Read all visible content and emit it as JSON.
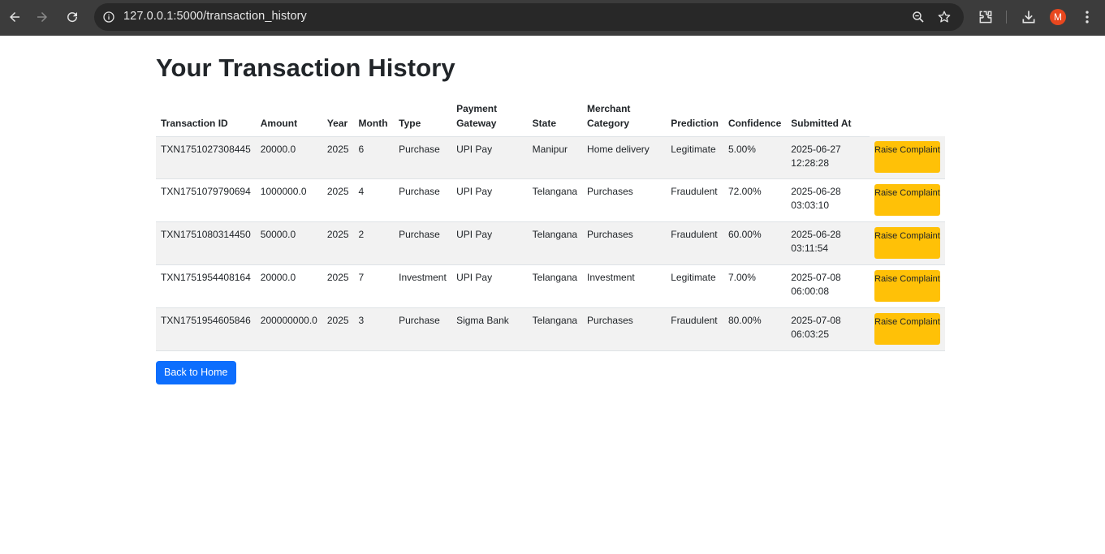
{
  "browser": {
    "url": "127.0.0.1:5000/transaction_history",
    "profile_initial": "M"
  },
  "page": {
    "title": "Your Transaction History",
    "back_home_label": "Back to Home"
  },
  "table": {
    "headers": [
      "Transaction ID",
      "Amount",
      "Year",
      "Month",
      "Type",
      "Payment Gateway",
      "State",
      "Merchant Category",
      "Prediction",
      "Confidence",
      "Submitted At",
      ""
    ],
    "rows": [
      {
        "id": "TXN1751027308445",
        "amount": "20000.0",
        "year": "2025",
        "month": "6",
        "type": "Purchase",
        "gateway": "UPI Pay",
        "state": "Manipur",
        "category": "Home delivery",
        "prediction": "Legitimate",
        "confidence": "5.00%",
        "date": "2025-06-27",
        "time": "12:28:28",
        "action": "Raise Complaint"
      },
      {
        "id": "TXN1751079790694",
        "amount": "1000000.0",
        "year": "2025",
        "month": "4",
        "type": "Purchase",
        "gateway": "UPI Pay",
        "state": "Telangana",
        "category": "Purchases",
        "prediction": "Fraudulent",
        "confidence": "72.00%",
        "date": "2025-06-28",
        "time": "03:03:10",
        "action": "Raise Complaint"
      },
      {
        "id": "TXN1751080314450",
        "amount": "50000.0",
        "year": "2025",
        "month": "2",
        "type": "Purchase",
        "gateway": "UPI Pay",
        "state": "Telangana",
        "category": "Purchases",
        "prediction": "Fraudulent",
        "confidence": "60.00%",
        "date": "2025-06-28",
        "time": "03:11:54",
        "action": "Raise Complaint"
      },
      {
        "id": "TXN1751954408164",
        "amount": "20000.0",
        "year": "2025",
        "month": "7",
        "type": "Investment",
        "gateway": "UPI Pay",
        "state": "Telangana",
        "category": "Investment",
        "prediction": "Legitimate",
        "confidence": "7.00%",
        "date": "2025-07-08",
        "time": "06:00:08",
        "action": "Raise Complaint"
      },
      {
        "id": "TXN1751954605846",
        "amount": "200000000.0",
        "year": "2025",
        "month": "3",
        "type": "Purchase",
        "gateway": "Sigma Bank",
        "state": "Telangana",
        "category": "Purchases",
        "prediction": "Fraudulent",
        "confidence": "80.00%",
        "date": "2025-07-08",
        "time": "06:03:25",
        "action": "Raise Complaint"
      }
    ]
  },
  "colors": {
    "complaint_button": "#ffc107",
    "home_button": "#0d6efd",
    "row_stripe": "#f2f2f2",
    "browser_bar": "#3c3c3c"
  }
}
